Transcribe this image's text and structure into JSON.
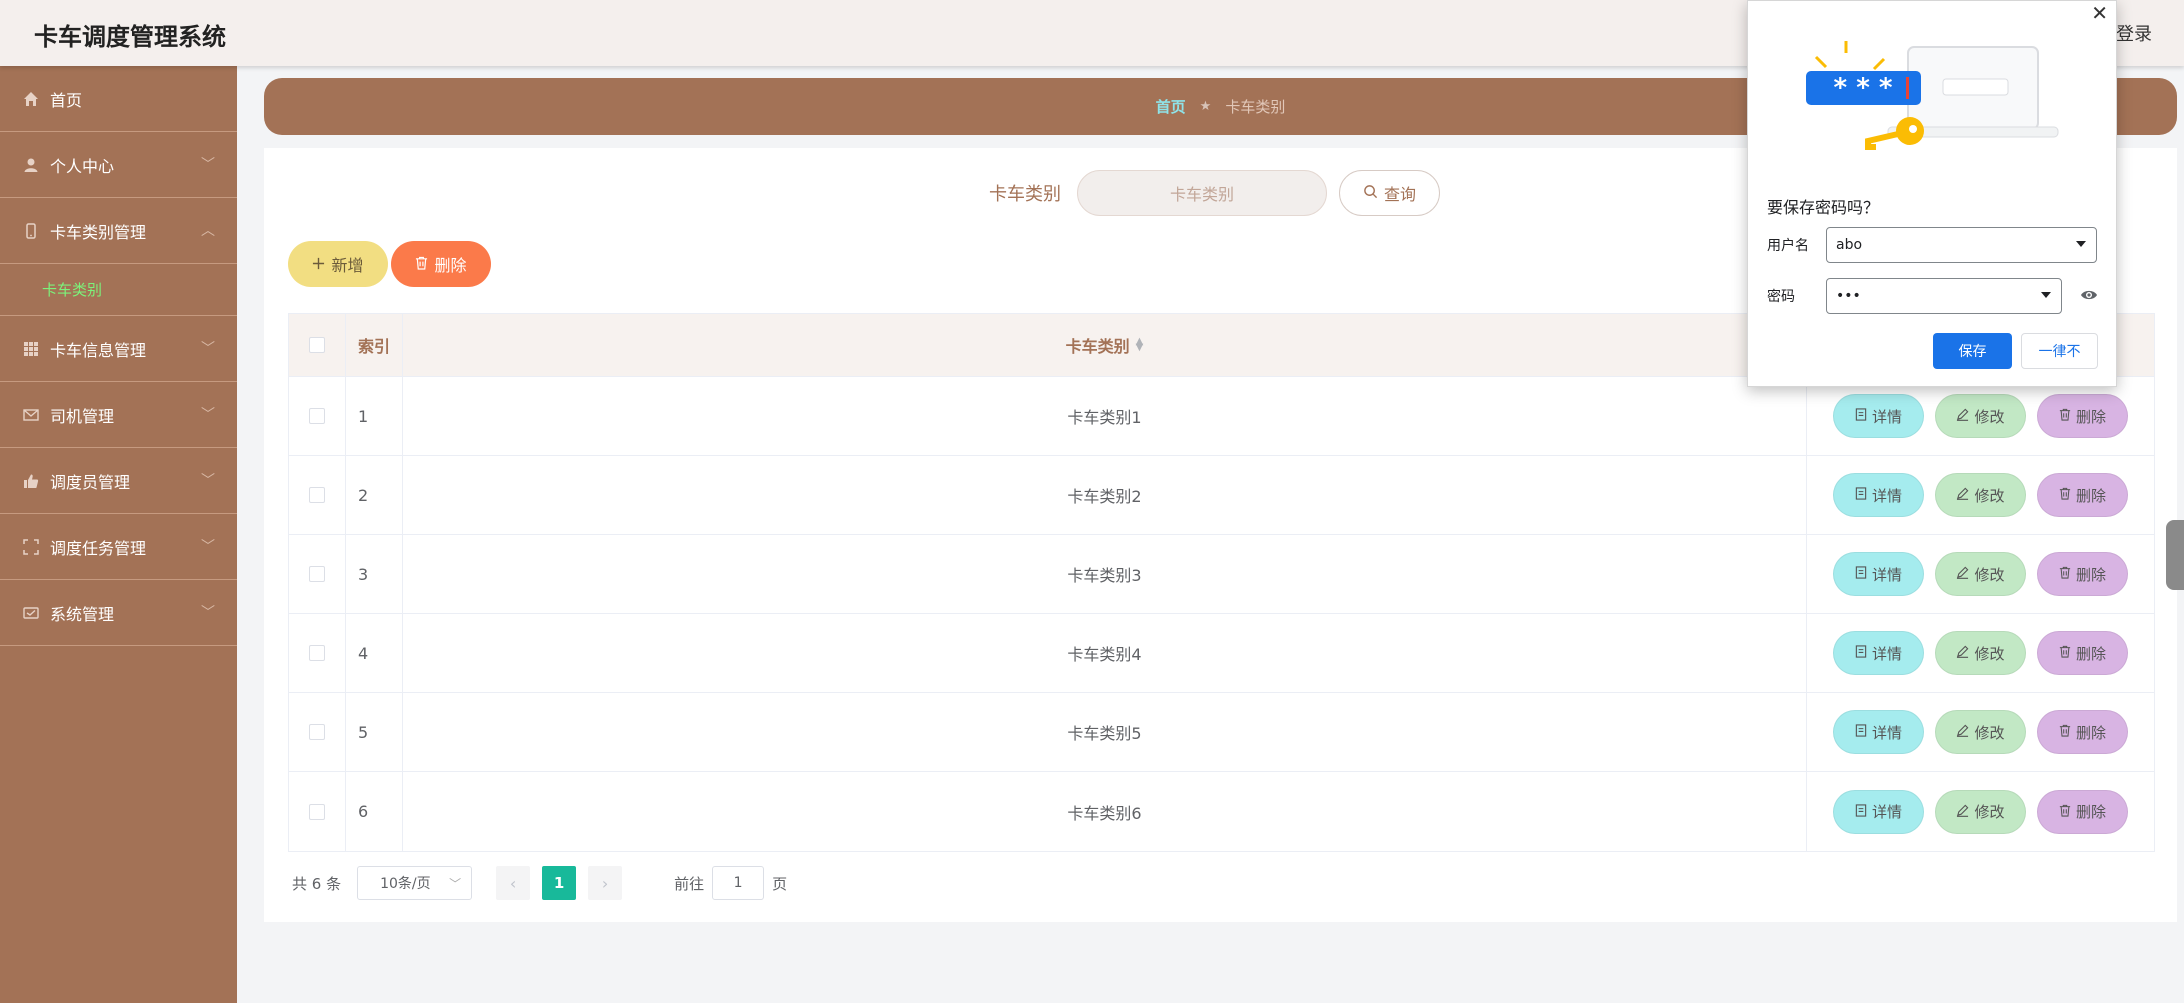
{
  "header": {
    "title": "卡车调度管理系统",
    "right_link": "登录"
  },
  "sidebar": {
    "items": [
      {
        "label": "首页",
        "icon": "home-icon"
      },
      {
        "label": "个人中心",
        "icon": "user-icon",
        "arrow": "﹀"
      },
      {
        "label": "卡车类别管理",
        "icon": "phone-icon",
        "arrow": "︿"
      },
      {
        "label": "卡车信息管理",
        "icon": "grid-icon",
        "arrow": "﹀"
      },
      {
        "label": "司机管理",
        "icon": "mail-icon",
        "arrow": "﹀"
      },
      {
        "label": "调度员管理",
        "icon": "thumb-icon",
        "arrow": "﹀"
      },
      {
        "label": "调度任务管理",
        "icon": "fullscreen-icon",
        "arrow": "﹀"
      },
      {
        "label": "系统管理",
        "icon": "message-icon",
        "arrow": "﹀"
      }
    ],
    "submenu": {
      "label": "卡车类别"
    }
  },
  "breadcrumb": {
    "home": "首页",
    "sep": "★",
    "current": "卡车类别"
  },
  "search": {
    "label": "卡车类别",
    "placeholder": "卡车类别",
    "button": "查询"
  },
  "actions": {
    "add": "新增",
    "delete": "删除"
  },
  "table": {
    "headers": {
      "index": "索引",
      "name": "卡车类别"
    },
    "rows": [
      {
        "index": "1",
        "name": "卡车类别1"
      },
      {
        "index": "2",
        "name": "卡车类别2"
      },
      {
        "index": "3",
        "name": "卡车类别3"
      },
      {
        "index": "4",
        "name": "卡车类别4"
      },
      {
        "index": "5",
        "name": "卡车类别5"
      },
      {
        "index": "6",
        "name": "卡车类别6"
      }
    ],
    "ops": {
      "detail": "详情",
      "edit": "修改",
      "delete": "删除"
    }
  },
  "pagination": {
    "total": "共 6 条",
    "page_size": "10条/页",
    "current": "1",
    "goto_prefix": "前往",
    "goto_value": "1",
    "goto_suffix": "页"
  },
  "password_popup": {
    "title": "要保存密码吗？",
    "username_label": "用户名",
    "username_value": "abo",
    "password_label": "密码",
    "password_value": "•••",
    "save": "保存",
    "never": "一律不",
    "close": "✕"
  },
  "colors": {
    "brand": "#a37256",
    "accent_green": "#18b99a",
    "popup_blue": "#1a73e8"
  }
}
